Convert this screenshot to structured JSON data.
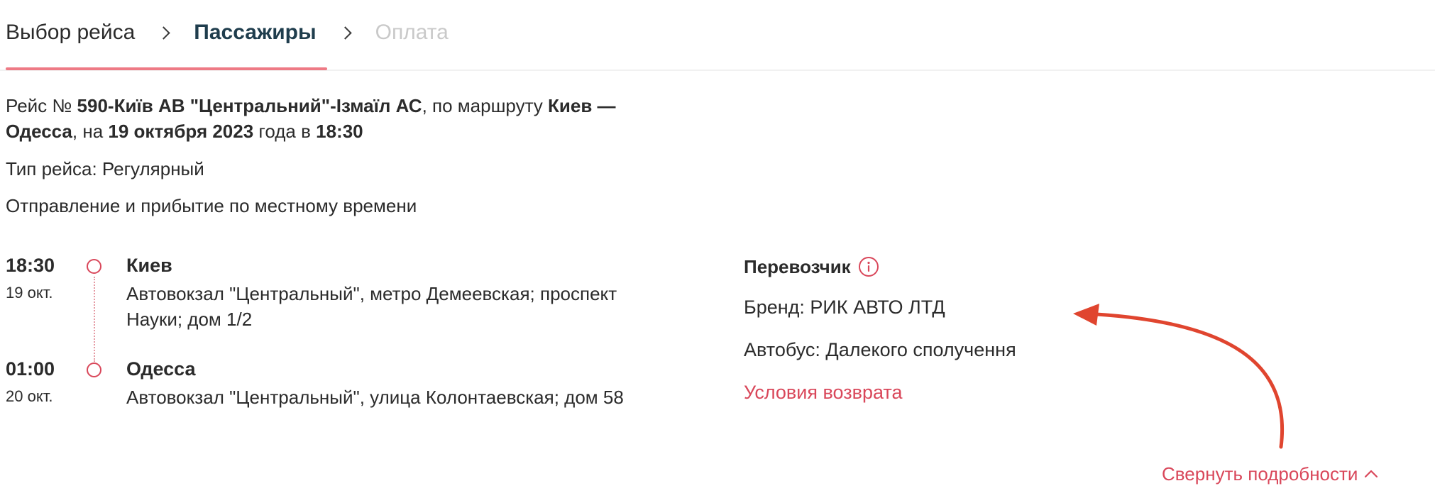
{
  "stepper": {
    "steps": [
      {
        "label": "Выбор рейса",
        "state": "done"
      },
      {
        "label": "Пассажиры",
        "state": "active"
      },
      {
        "label": "Оплата",
        "state": "future"
      }
    ]
  },
  "trip": {
    "route_prefix": "Рейс № ",
    "route_number": "590-Київ АВ \"Центральний\"-Ізмаїл АС",
    "route_mid": ", по маршруту ",
    "route_cities": "Киев — Одесса",
    "date_mid": ", на ",
    "date": "19 октября 2023",
    "time_mid": " года в ",
    "time": "18:30",
    "type_line": "Тип рейса: Регулярный",
    "local_time_note": "Отправление и прибытие по местному времени"
  },
  "stops": [
    {
      "time": "18:30",
      "date": "19 окт.",
      "city": "Киев",
      "address": "Автовокзал \"Центральный\", метро Демеевская; проспект Науки; дом 1/2"
    },
    {
      "time": "01:00",
      "date": "20 окт.",
      "city": "Одесса",
      "address": "Автовокзал \"Центральный\", улица Колонтаевская; дом 58"
    }
  ],
  "carrier": {
    "title": "Перевозчик",
    "brand": "Бренд: РИК АВТО ЛТД",
    "bus": "Автобус: Далекого сполучення",
    "refund_link": "Условия возврата"
  },
  "collapse_link": "Свернуть подробности",
  "colors": {
    "accent": "#d9475a",
    "active_step": "#1f3d4d",
    "future_step": "#c9c9c9",
    "annotation_arrow": "#e0452f"
  },
  "icons": {
    "info": "info-circle-icon",
    "collapse": "chevron-up-icon",
    "breadcrumb_separator": "chevron-right-icon"
  }
}
